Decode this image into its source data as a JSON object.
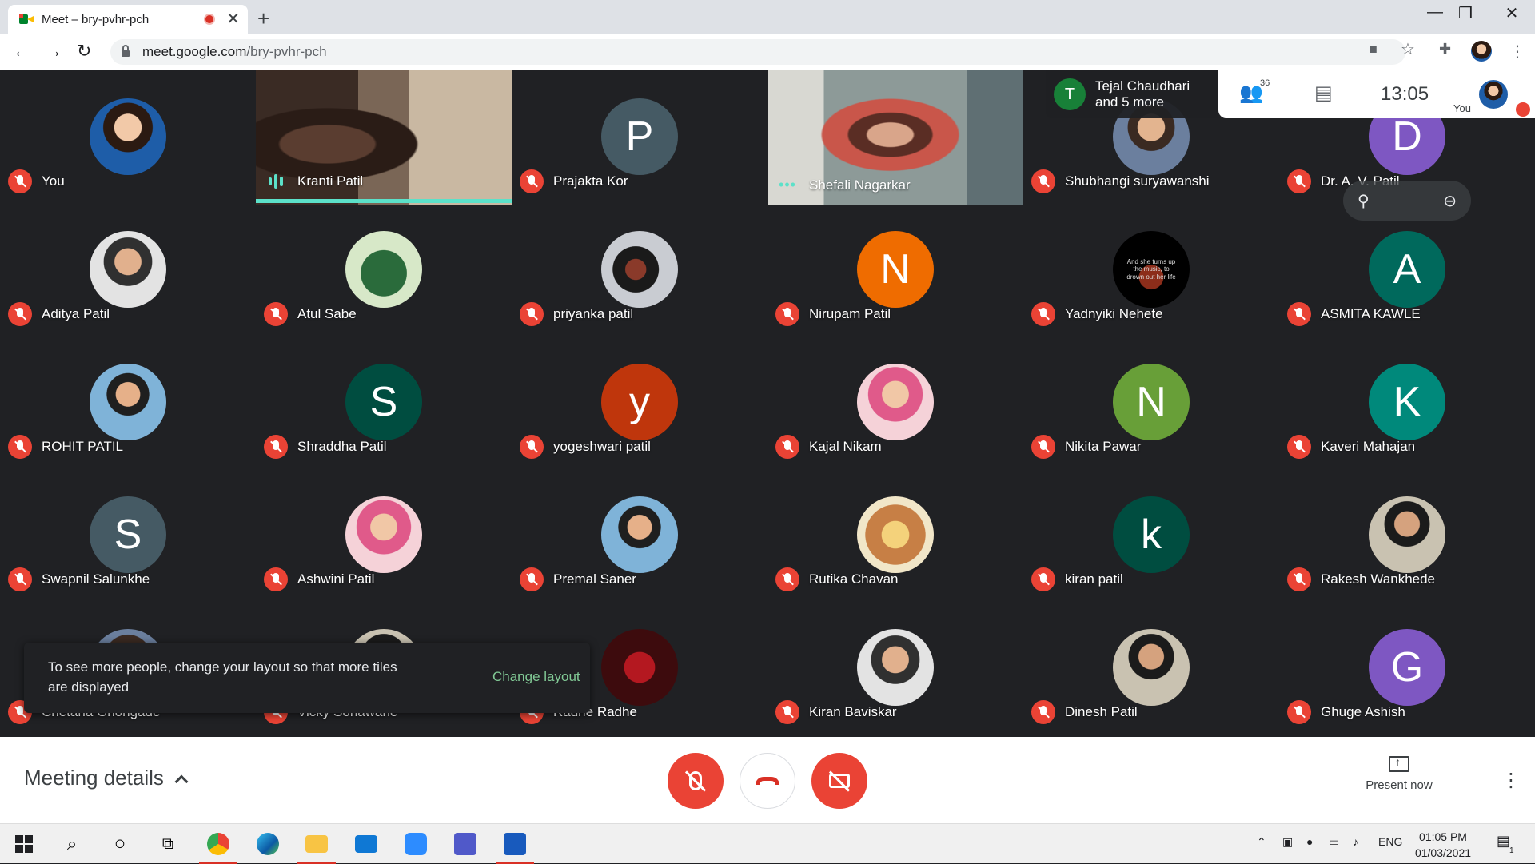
{
  "browser": {
    "tab_title": "Meet – bry-pvhr-pch",
    "tab_close": "✕",
    "new_tab": "+",
    "url_host": "meet.google.com",
    "url_path": "/bry-pvhr-pch",
    "win_min": "—",
    "win_max": "❐",
    "win_close": "✕"
  },
  "tiles": [
    {
      "name": "You",
      "initial": "",
      "avatar_style": "p",
      "avatar_color": ""
    },
    {
      "name": "Kranti Patil",
      "type": "video-speaking"
    },
    {
      "name": "Prajakta Kor",
      "initial": "P",
      "avatar_color": "#455a64"
    },
    {
      "name": "Shefali Nagarkar",
      "type": "video"
    },
    {
      "name": "Shubhangi suryawanshi",
      "initial": "",
      "avatar_style": "photo"
    },
    {
      "name": "Dr. A. V. Patil",
      "initial": "D",
      "avatar_color": "#7e57c2"
    },
    {
      "name": "Aditya Patil",
      "initial": "",
      "avatar_style": "h"
    },
    {
      "name": "Atul Sabe",
      "initial": "",
      "avatar_style": "k"
    },
    {
      "name": "priyanka patil",
      "initial": "",
      "avatar_style": "c"
    },
    {
      "name": "Nirupam Patil",
      "initial": "N",
      "avatar_color": "#ef6c00"
    },
    {
      "name": "Yadnyiki Nehete",
      "initial": "",
      "avatar_style": "y"
    },
    {
      "name": "ASMITA KAWLE",
      "initial": "A",
      "avatar_color": "#00695c"
    },
    {
      "name": "ROHIT PATIL",
      "initial": "",
      "avatar_style": "f"
    },
    {
      "name": "Shraddha Patil",
      "initial": "S",
      "avatar_color": "#004d40"
    },
    {
      "name": "yogeshwari patil",
      "initial": "y",
      "avatar_color": "#bf360c"
    },
    {
      "name": "Kajal Nikam",
      "initial": "",
      "avatar_style": "e"
    },
    {
      "name": "Nikita Pawar",
      "initial": "N",
      "avatar_color": "#689f38"
    },
    {
      "name": "Kaveri Mahajan",
      "initial": "K",
      "avatar_color": "#00897b"
    },
    {
      "name": "Swapnil Salunkhe",
      "initial": "S",
      "avatar_color": "#455a64"
    },
    {
      "name": "Ashwini Patil",
      "initial": "",
      "avatar_style": "e"
    },
    {
      "name": "Premal Saner",
      "initial": "",
      "avatar_style": "f"
    },
    {
      "name": "Rutika Chavan",
      "initial": "",
      "avatar_style": "g"
    },
    {
      "name": "kiran patil",
      "initial": "k",
      "avatar_color": "#004d40"
    },
    {
      "name": "Rakesh Wankhede",
      "initial": "",
      "avatar_style": "b"
    },
    {
      "name": "Chetana Ghongade",
      "initial": "",
      "avatar_style": "photo"
    },
    {
      "name": "Vicky Sonawane",
      "initial": "",
      "avatar_style": "b"
    },
    {
      "name": "Radhe Radhe",
      "initial": "",
      "avatar_style": "d"
    },
    {
      "name": "Kiran Baviskar",
      "initial": "",
      "avatar_style": "h"
    },
    {
      "name": "Dinesh Patil",
      "initial": "",
      "avatar_style": "b"
    },
    {
      "name": "Ghuge Ashish",
      "initial": "G",
      "avatar_color": "#7e57c2"
    }
  ],
  "yadnyiki_avatar_text": "And she turns up the music, to drown out her life",
  "names_card": {
    "initial": "T",
    "line1": "Tejal Chaudhari",
    "line2": "and 5 more"
  },
  "info_card": {
    "people_count": "36",
    "time": "13:05",
    "you_label": "You"
  },
  "toast": {
    "text": "To see more people, change your layout so that more tiles are displayed",
    "action": "Change layout"
  },
  "controls": {
    "meeting_details": "Meeting details",
    "present_now": "Present now"
  },
  "taskbar": {
    "lang": "ENG",
    "time": "01:05 PM",
    "date": "01/03/2021",
    "notif_count": "1"
  },
  "colors": {
    "accent_speaking": "#5ce1c9",
    "danger": "#ea4335",
    "background": "#202124"
  }
}
